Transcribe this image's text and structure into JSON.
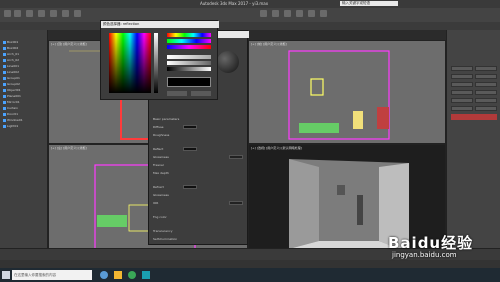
{
  "window": {
    "title": "Autodesk 3ds Max 2017 - yi3.max"
  },
  "search": {
    "placeholder": "输入关键字或短语"
  },
  "color_dialog": {
    "title": "颜色选择器: reflection"
  },
  "viewports": {
    "top_left": "[+] [顶] [用户定义] [线框]",
    "top_right": "[+] [前] [用户定义] [线框]",
    "bottom_left": "[+] [左] [用户定义] [线框]",
    "bottom_right": "[+] [透视] [用户定义] [默认明暗处理]"
  },
  "scene_items": [
    "Box001",
    "Box002",
    "Arch_01",
    "Arch_02",
    "Line001",
    "Line002",
    "Group01",
    "Group02",
    "Object01",
    "Plane001",
    "Mirror01",
    "Curtain",
    "Door01",
    "Window01",
    "Light01"
  ],
  "material": {
    "section": "Basic parameters",
    "rows": [
      "Diffuse",
      "Roughness",
      "Reflect",
      "Glossiness",
      "Fresnel",
      "Max depth",
      "Refract",
      "Glossiness",
      "IOR",
      "Fog color",
      "Translucency",
      "Self-illumination"
    ]
  },
  "watermark": {
    "main": "Baidu经验",
    "sub": "jingyan.baidu.com"
  },
  "taskbar": {
    "search_text": "在这里输入你要搜索的内容"
  }
}
